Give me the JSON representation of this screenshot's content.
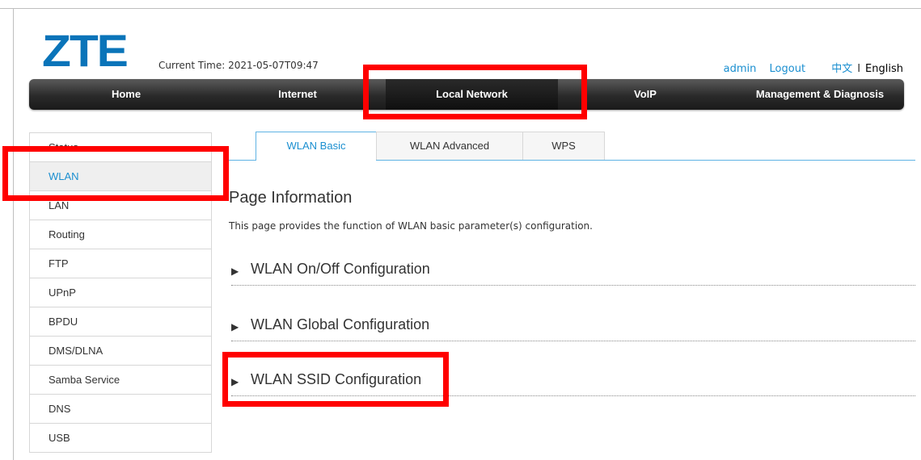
{
  "header": {
    "logo_text": "ZTE",
    "current_time_label": "Current Time: ",
    "current_time_value": "2021-05-07T09:47",
    "user": "admin",
    "logout": "Logout",
    "lang_zh": "中文",
    "lang_sep": "I",
    "lang_en": "English"
  },
  "nav": {
    "items": [
      {
        "label": "Home"
      },
      {
        "label": "Internet"
      },
      {
        "label": "Local Network"
      },
      {
        "label": "VoIP"
      },
      {
        "label": "Management & Diagnosis"
      }
    ],
    "active": "Local Network"
  },
  "sidebar": {
    "items": [
      {
        "label": "Status"
      },
      {
        "label": "WLAN"
      },
      {
        "label": "LAN"
      },
      {
        "label": "Routing"
      },
      {
        "label": "FTP"
      },
      {
        "label": "UPnP"
      },
      {
        "label": "BPDU"
      },
      {
        "label": "DMS/DLNA"
      },
      {
        "label": "Samba Service"
      },
      {
        "label": "DNS"
      },
      {
        "label": "USB"
      }
    ],
    "active": "WLAN"
  },
  "tabs": {
    "items": [
      {
        "label": "WLAN Basic"
      },
      {
        "label": "WLAN Advanced"
      },
      {
        "label": "WPS"
      }
    ],
    "active": "WLAN Basic"
  },
  "main": {
    "title": "Page Information",
    "description": "This page provides the function of WLAN basic parameter(s) configuration.",
    "sections": [
      {
        "label": "WLAN On/Off Configuration"
      },
      {
        "label": "WLAN Global Configuration"
      },
      {
        "label": "WLAN SSID Configuration"
      }
    ]
  },
  "colors": {
    "brand": "#0a74b9",
    "link": "#1b8fd0",
    "highlight": "#ff0000"
  }
}
